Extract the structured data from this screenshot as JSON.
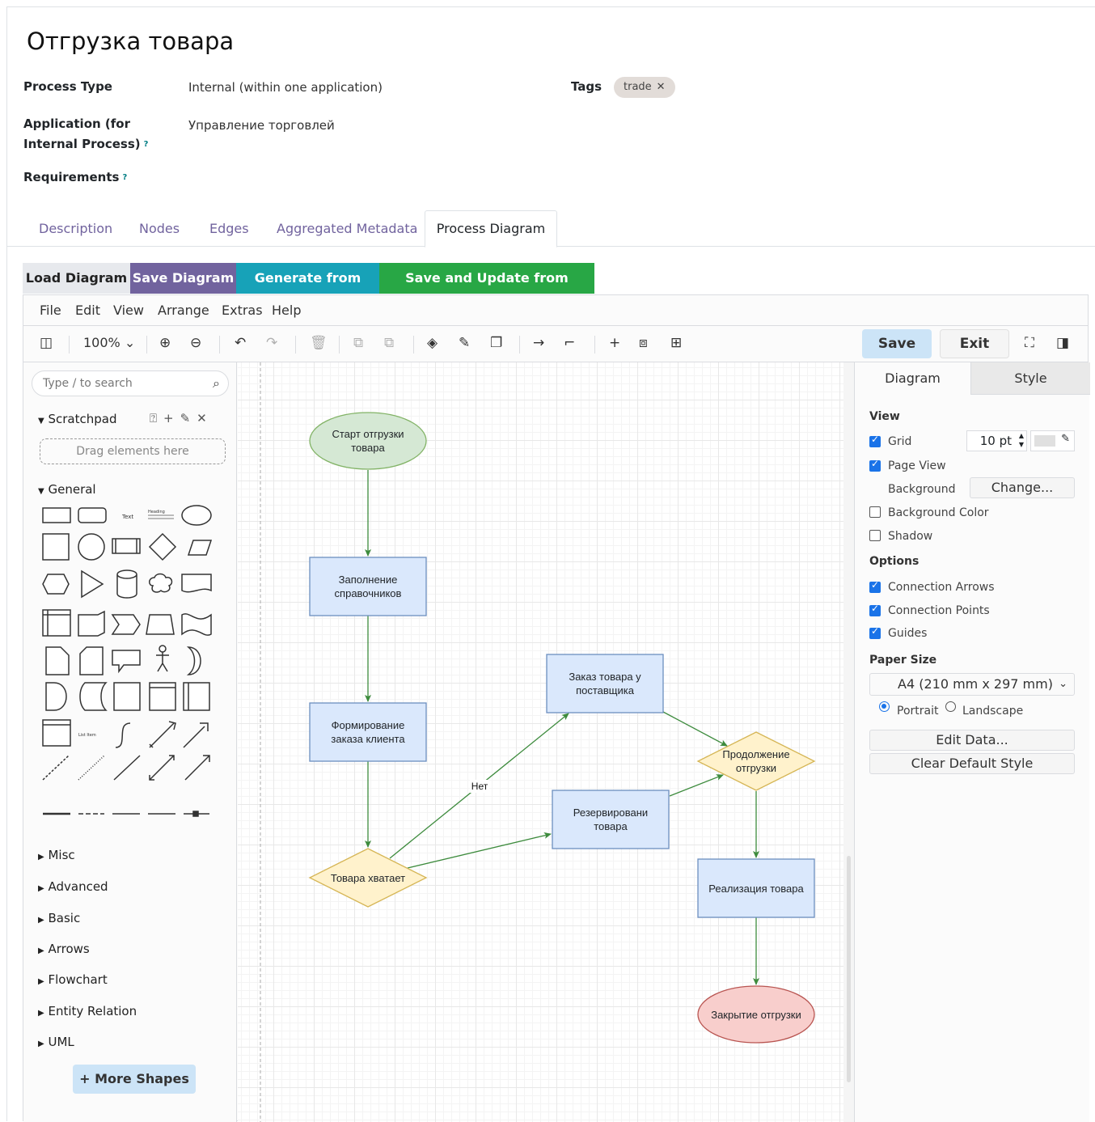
{
  "page": {
    "title": "Отгрузка товара"
  },
  "fields": {
    "process_type": {
      "label": "Process Type",
      "value": "Internal (within one application)"
    },
    "application": {
      "label_line1": "Application (for",
      "label_line2": "Internal Process)",
      "value": "Управление торговлей"
    },
    "requirements": {
      "label": "Requirements"
    },
    "tags": {
      "label": "Tags",
      "items": [
        "trade"
      ]
    }
  },
  "tabs": [
    "Description",
    "Nodes",
    "Edges",
    "Aggregated Metadata",
    "Process Diagram"
  ],
  "actions": {
    "load": {
      "label": "Load Diagram",
      "color": "#e7e9ed"
    },
    "save": {
      "label": "Save Diagram",
      "color": "#71639e"
    },
    "generate": {
      "label": "Generate from Data",
      "color": "#17a2b8"
    },
    "save_update": {
      "label": "Save and Update from Diagram",
      "color": "#28a745"
    }
  },
  "menu": [
    "File",
    "Edit",
    "View",
    "Arrange",
    "Extras",
    "Help"
  ],
  "toolbar": {
    "zoom": "100%",
    "save_label": "Save",
    "exit_label": "Exit"
  },
  "left_panel": {
    "search_placeholder": "Type / to search",
    "scratchpad": "Scratchpad",
    "drag_hint": "Drag elements here",
    "general": "General",
    "shape_text": "Text",
    "shape_heading": "Heading",
    "shape_list_item": "List Item",
    "sections": [
      "Misc",
      "Advanced",
      "Basic",
      "Arrows",
      "Flowchart",
      "Entity Relation",
      "UML"
    ],
    "more_shapes": "+ More Shapes"
  },
  "diagram": {
    "nodes": {
      "start": "Старт отгрузки товара",
      "fill": "Заполнение справочников",
      "form": "Формирование заказа клиента",
      "enough": "Товара хватает",
      "order": "Заказ товара у поставщика",
      "reserve": "Резервировани товара",
      "continue": "Продолжение отгрузки",
      "realize": "Реализация товара",
      "close": "Закрытие отгрузки"
    },
    "edge_label": "Нет",
    "colors": {
      "start": "#d5e8d4",
      "process": "#dae8fc",
      "decision": "#fff2cc",
      "end": "#f8cecc",
      "edge": "#3d8b3d"
    }
  },
  "right_panel": {
    "tabs": [
      "Diagram",
      "Style"
    ],
    "view_header": "View",
    "grid": "Grid",
    "grid_size": "10 pt",
    "page_view": "Page View",
    "background": "Background",
    "change": "Change...",
    "background_color": "Background Color",
    "shadow": "Shadow",
    "options_header": "Options",
    "connection_arrows": "Connection Arrows",
    "connection_points": "Connection Points",
    "guides": "Guides",
    "paper_size_header": "Paper Size",
    "paper_size": "A4 (210 mm x 297 mm)",
    "portrait": "Portrait",
    "landscape": "Landscape",
    "edit_data": "Edit Data...",
    "clear_default_style": "Clear Default Style"
  }
}
